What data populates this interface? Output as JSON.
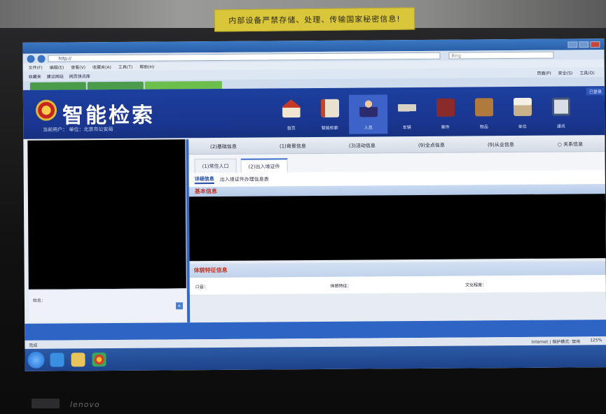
{
  "sticker": {
    "text": "内部设备严禁存储、处理、传输国家秘密信息!"
  },
  "browser": {
    "window_title": "",
    "address": "http://",
    "search_placeholder": "Bing",
    "menu": [
      "文件(F)",
      "编辑(E)",
      "查看(V)",
      "收藏夹(A)",
      "工具(T)",
      "帮助(H)"
    ],
    "favorites": [
      "收藏夹",
      "建议网站",
      "网页快讯库"
    ],
    "tools": [
      "页面(P)",
      "安全(S)",
      "工具(O)"
    ],
    "tabs": [
      "",
      "",
      ""
    ]
  },
  "app": {
    "title": "智能检索",
    "user_line": "当前用户：  单位：北京市公安局",
    "select_indicator": "已登录",
    "nav": [
      {
        "label": "首页",
        "icon": "home-icon"
      },
      {
        "label": "智能检索",
        "icon": "search-doc-icon"
      },
      {
        "label": "人员",
        "icon": "person-icon",
        "active": true
      },
      {
        "label": "车辆",
        "icon": "car-icon"
      },
      {
        "label": "案件",
        "icon": "book-icon"
      },
      {
        "label": "物品",
        "icon": "card-icon"
      },
      {
        "label": "单位",
        "icon": "building-icon"
      },
      {
        "label": "通讯",
        "icon": "phone-icon"
      }
    ]
  },
  "main": {
    "top_tabs": [
      "(2)基础信息",
      "(1)背景信息",
      "(3)活动信息",
      "(9)全点信息",
      "(9)从业信息",
      "关系信息"
    ],
    "sub_tabs": [
      "(1)常住人口",
      "(2)出入境证件"
    ],
    "detail_links": [
      "详细信息",
      "出入境证件办理信息表"
    ],
    "section_basic": "基本信息",
    "section_features": "体貌特征信息",
    "feature_fields": [
      "口音：",
      "体貌特征：",
      "文化程度："
    ]
  },
  "left": {
    "label": "姓名：",
    "watermark": ""
  },
  "footer": {
    "copyright": ""
  },
  "status": {
    "left": "完成",
    "zone": "Internet | 保护模式: 禁用",
    "zoom": "125%"
  }
}
